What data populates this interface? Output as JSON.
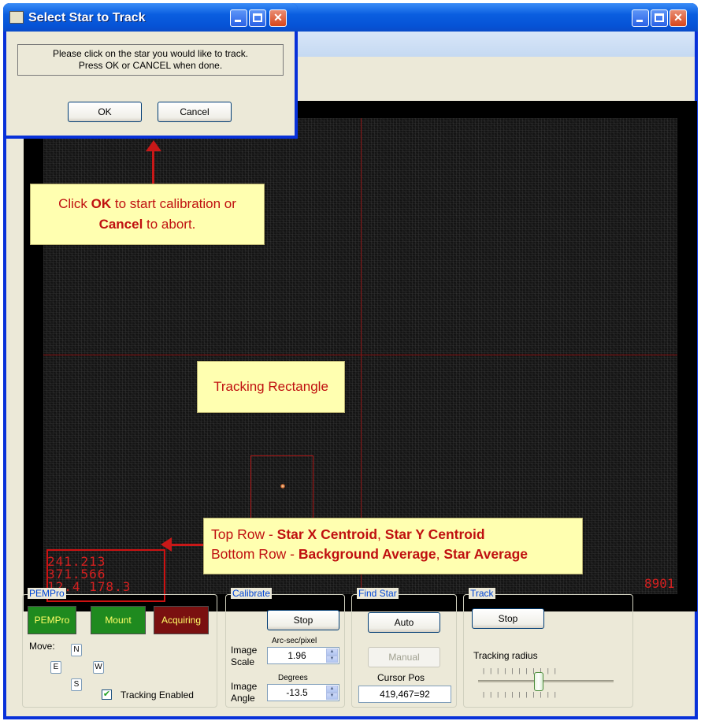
{
  "dialog": {
    "title": "Select Star to Track",
    "message_line1": "Please click on the star you would like to track.",
    "message_line2": "Press OK or CANCEL when done.",
    "ok_label": "OK",
    "cancel_label": "Cancel"
  },
  "callouts": {
    "ok_cancel_pre1": "Click ",
    "ok_cancel_bold1": "OK",
    "ok_cancel_post1": " to start calibration or",
    "ok_cancel_bold2": "Cancel",
    "ok_cancel_post2": " to abort.",
    "tracking_rectangle": "Tracking Rectangle",
    "rows_pre1": "Top Row - ",
    "rows_bold1": "Star X Centroid",
    "rows_sep1": ", ",
    "rows_bold2": "Star Y Centroid",
    "rows_pre2": "Bottom Row - ",
    "rows_bold3": "Background Average",
    "rows_sep2": ", ",
    "rows_bold4": "Star Average"
  },
  "image": {
    "readout_top": "241.213 371.566",
    "readout_bottom": "12.4  178.3",
    "frame_counter": "8901"
  },
  "pempro": {
    "label": "PEMPro",
    "pempro_btn": "PEMPro",
    "mount_btn": "Mount",
    "acquiring_btn": "Acquiring",
    "move_label": "Move:",
    "n": "N",
    "e": "E",
    "w": "W",
    "s": "S",
    "tracking_enabled": "Tracking Enabled",
    "tracking_checked": true,
    "colors": {
      "pempro": "#1f8a1f",
      "mount": "#1f8a1f",
      "acquiring": "#7a1010",
      "text_light": "#ffff66"
    }
  },
  "calibrate": {
    "label": "Calibrate",
    "stop": "Stop",
    "image_scale_l1": "Image",
    "image_scale_l2": "Scale",
    "arc_sec": "Arc-sec/pixel",
    "scale_value": "1.96",
    "image_angle_l1": "Image",
    "image_angle_l2": "Angle",
    "degrees": "Degrees",
    "angle_value": "-13.5"
  },
  "find_star": {
    "label": "Find Star",
    "auto": "Auto",
    "manual": "Manual",
    "cursor_pos_label": "Cursor Pos",
    "cursor_pos_value": "419,467=92"
  },
  "track": {
    "label": "Track",
    "stop": "Stop",
    "tracking_radius": "Tracking radius",
    "tracking_radius_level": 0.45
  }
}
